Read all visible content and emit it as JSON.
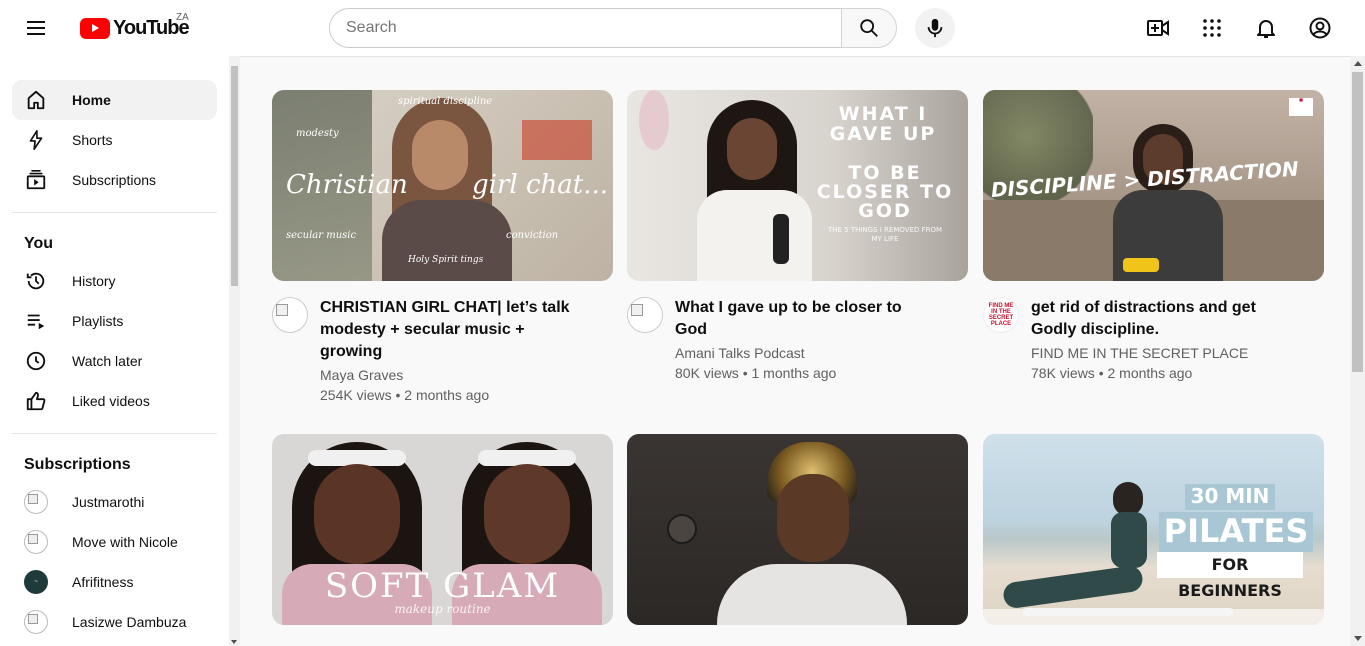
{
  "brand": {
    "logo_text": "YouTube",
    "country": "ZA",
    "accent": "#ff0000"
  },
  "search": {
    "placeholder": "Search"
  },
  "sidebar": {
    "main_items": [
      {
        "label": "Home",
        "icon": "home-icon"
      },
      {
        "label": "Shorts",
        "icon": "shorts-icon"
      },
      {
        "label": "Subscriptions",
        "icon": "subscriptions-icon"
      }
    ],
    "you_title": "You",
    "you_items": [
      {
        "label": "History",
        "icon": "history-icon"
      },
      {
        "label": "Playlists",
        "icon": "playlists-icon"
      },
      {
        "label": "Watch later",
        "icon": "watch-later-icon"
      },
      {
        "label": "Liked videos",
        "icon": "liked-videos-icon"
      }
    ],
    "subs_title": "Subscriptions",
    "subscriptions": [
      {
        "label": "Justmarothi"
      },
      {
        "label": "Move with Nicole"
      },
      {
        "label": "Afrifitness"
      },
      {
        "label": "Lasizwe Dambuza"
      }
    ]
  },
  "videos": [
    {
      "title": "CHRISTIAN GIRL CHAT| let’s talk modesty + secular music + growing",
      "channel": "Maya Graves",
      "stats": "254K views • 2 months ago",
      "overlay": {
        "left": "Christian",
        "right": "girl chat...",
        "tags": [
          "spiritual discipline",
          "modesty",
          "secular music",
          "conviction",
          "Holy Spirit tings"
        ]
      }
    },
    {
      "title": "What I gave up to be closer to God",
      "channel": "Amani Talks Podcast",
      "stats": "80K views • 1 months ago",
      "overlay": {
        "line1": "WHAT I GAVE UP",
        "line2": "TO BE CLOSER TO GOD",
        "line3": "THE 5 THINGS I REMOVED FROM MY LIFE"
      }
    },
    {
      "title": "get rid of distractions and get Godly discipline.",
      "channel": "FIND ME IN THE SECRET PLACE",
      "stats": "78K views • 2 months ago",
      "overlay": {
        "text": "DISCIPLINE > DISTRACTION",
        "avatar_text": "FIND ME IN THE SECRET PLACE"
      }
    },
    {
      "overlay": {
        "title": "SOFT GLAM",
        "subtitle": "makeup routine"
      }
    },
    {
      "overlay": {}
    },
    {
      "overlay": {
        "line1": "30 MIN",
        "line2": "PILATES",
        "line3": "FOR BEGINNERS"
      }
    }
  ]
}
